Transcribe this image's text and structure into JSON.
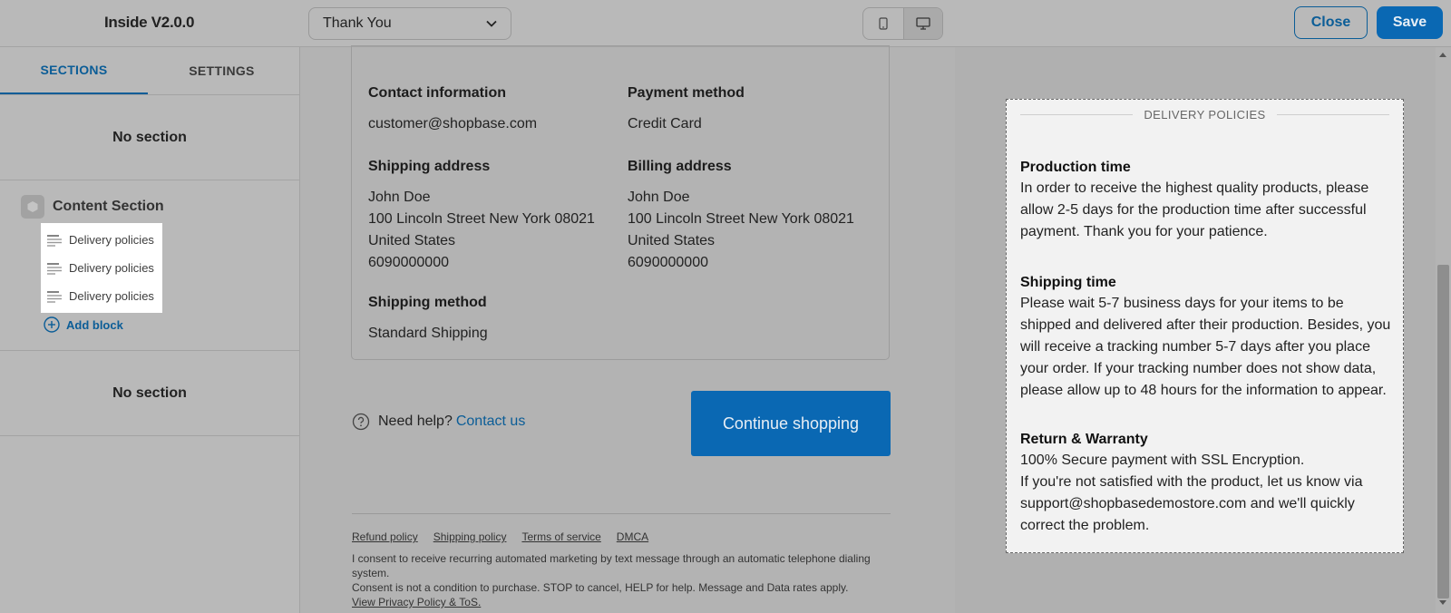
{
  "app": {
    "title": "Inside V2.0.0"
  },
  "topbar": {
    "page_select": "Thank You",
    "close_label": "Close",
    "save_label": "Save"
  },
  "sidebar": {
    "tabs": [
      {
        "label": "SECTIONS",
        "active": true
      },
      {
        "label": "SETTINGS",
        "active": false
      }
    ],
    "no_section_top": "No section",
    "content_section": {
      "title": "Content Section",
      "blocks": [
        {
          "label": "Delivery policies"
        },
        {
          "label": "Delivery policies"
        },
        {
          "label": "Delivery policies"
        }
      ],
      "add_block": "Add block"
    },
    "no_section_bottom": "No section"
  },
  "order": {
    "contact": {
      "heading": "Contact information",
      "value": "customer@shopbase.com"
    },
    "payment": {
      "heading": "Payment method",
      "value": "Credit Card"
    },
    "shipping_address": {
      "heading": "Shipping address",
      "lines": [
        "John Doe",
        "100 Lincoln Street New York 08021",
        "United States",
        "6090000000"
      ]
    },
    "billing_address": {
      "heading": "Billing address",
      "lines": [
        "John Doe",
        "100 Lincoln Street New York 08021",
        "United States",
        "6090000000"
      ]
    },
    "shipping_method": {
      "heading": "Shipping method",
      "value": "Standard Shipping"
    },
    "help_text": "Need help?",
    "contact_link": "Contact us",
    "continue_label": "Continue shopping"
  },
  "footer": {
    "links": [
      "Refund policy",
      "Shipping policy",
      "Terms of service",
      "DMCA"
    ],
    "consent_line1": "I consent to receive recurring automated marketing by text message through an automatic telephone dialing system.",
    "consent_line2": "Consent is not a condition to purchase. STOP to cancel, HELP for help. Message and Data rates apply.",
    "privacy_link": "View Privacy Policy & ToS."
  },
  "policies": {
    "heading": "DELIVERY POLICIES",
    "sections": [
      {
        "title": "Production time",
        "body": "In order to receive the highest quality products, please allow 2-5 days for the production time after successful payment. Thank you for your patience."
      },
      {
        "title": "Shipping time",
        "body": "Please wait 5-7 business days for your items to be shipped and delivered after their production. Besides, you will receive a tracking number 5-7 days after you place your order. If your tracking number does not show data, please allow up to 48 hours for the information to appear."
      },
      {
        "title": "Return & Warranty",
        "body1": "100% Secure payment with SSL Encryption.",
        "body2": "If you're not satisfied with the product, let us know via support@shopbasedemostore.com and we'll quickly correct the problem."
      }
    ]
  },
  "colors": {
    "accent": "#0a68b3",
    "link": "#0b5d97"
  }
}
